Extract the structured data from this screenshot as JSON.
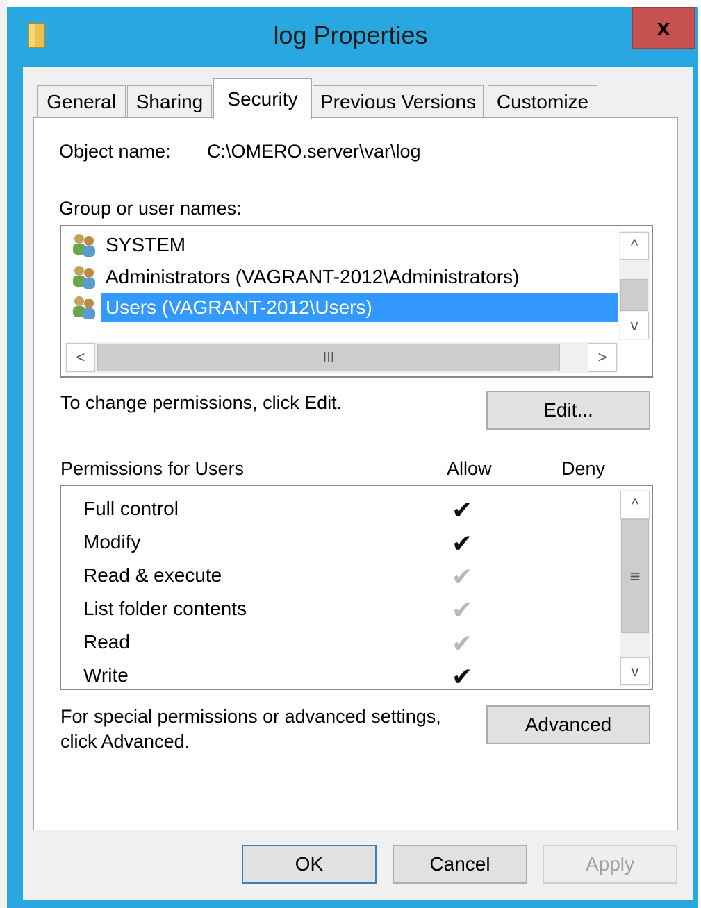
{
  "window": {
    "title": "log Properties",
    "close_glyph": "x",
    "accent_color": "#29a7e0"
  },
  "tabs": [
    {
      "label": "General",
      "active": false
    },
    {
      "label": "Sharing",
      "active": false
    },
    {
      "label": "Security",
      "active": true
    },
    {
      "label": "Previous Versions",
      "active": false
    },
    {
      "label": "Customize",
      "active": false
    }
  ],
  "object": {
    "label": "Object name:",
    "value": "C:\\OMERO.server\\var\\log"
  },
  "groups": {
    "label": "Group or user names:",
    "items": [
      {
        "name": "SYSTEM",
        "icon": "users-icon",
        "selected": false
      },
      {
        "name": "Administrators (VAGRANT-2012\\Administrators)",
        "icon": "users-icon",
        "selected": false
      },
      {
        "name": "Users (VAGRANT-2012\\Users)",
        "icon": "users-icon",
        "selected": true
      }
    ],
    "hscroll_grip": "III"
  },
  "change": {
    "text": "To change permissions, click Edit.",
    "edit_label": "Edit..."
  },
  "permissions": {
    "title": "Permissions for Users",
    "allow_header": "Allow",
    "deny_header": "Deny",
    "rows": [
      {
        "name": "Full control",
        "allow": "strong",
        "deny": ""
      },
      {
        "name": "Modify",
        "allow": "strong",
        "deny": ""
      },
      {
        "name": "Read & execute",
        "allow": "faint",
        "deny": ""
      },
      {
        "name": "List folder contents",
        "allow": "faint",
        "deny": ""
      },
      {
        "name": "Read",
        "allow": "faint",
        "deny": ""
      },
      {
        "name": "Write",
        "allow": "strong",
        "deny": ""
      }
    ],
    "vscroll_grip": "≡"
  },
  "advanced": {
    "text_line1": "For special permissions or advanced settings,",
    "text_line2": "click Advanced.",
    "button_label": "Advanced"
  },
  "footer": {
    "ok_label": "OK",
    "cancel_label": "Cancel",
    "apply_label": "Apply"
  },
  "glyphs": {
    "check": "✔",
    "up": "^",
    "down": "v",
    "left": "<",
    "right": ">"
  }
}
